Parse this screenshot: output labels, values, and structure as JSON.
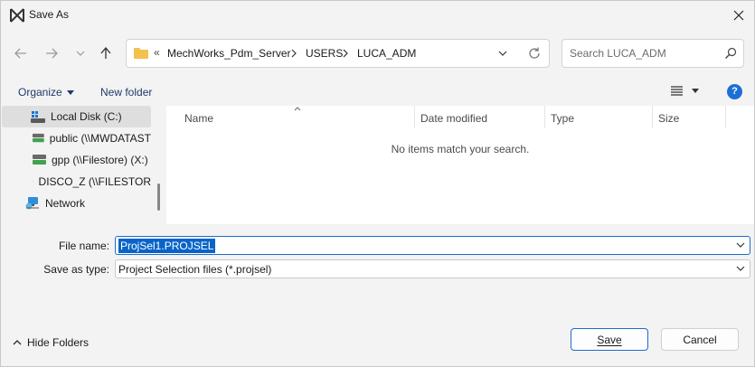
{
  "window": {
    "title": "Save As"
  },
  "address": {
    "overflow": "«",
    "breadcrumbs": [
      "MechWorks_Pdm_Server",
      "USERS",
      "LUCA_ADM"
    ]
  },
  "search": {
    "placeholder": "Search LUCA_ADM"
  },
  "commands": {
    "organize": "Organize",
    "new_folder": "New folder",
    "help": "?"
  },
  "nav_tree": [
    {
      "label": "Local Disk (C:)",
      "icon": "local-disk-icon",
      "selected": true
    },
    {
      "label": "public (\\\\MWDATAST",
      "icon": "network-drive-icon"
    },
    {
      "label": "gpp (\\\\Filestore) (X:)",
      "icon": "network-drive-icon"
    },
    {
      "label": "DISCO_Z (\\\\FILESTOR",
      "icon": "network-drive-icon"
    },
    {
      "label": "Network",
      "icon": "network-icon"
    }
  ],
  "columns": [
    "Name",
    "Date modified",
    "Type",
    "Size"
  ],
  "empty_message": "No items match your search.",
  "form": {
    "file_name_label": "File name:",
    "file_name_value": "ProjSel1.PROJSEL",
    "save_type_label": "Save as type:",
    "save_type_value": "Project Selection files (*.projsel)"
  },
  "footer": {
    "hide_folders": "Hide Folders",
    "save": "Save",
    "cancel": "Cancel"
  },
  "colors": {
    "accent": "#0a64c8",
    "help": "#1d6fd6",
    "folder": "#f2c14e",
    "drive_green": "#3fa34d"
  }
}
